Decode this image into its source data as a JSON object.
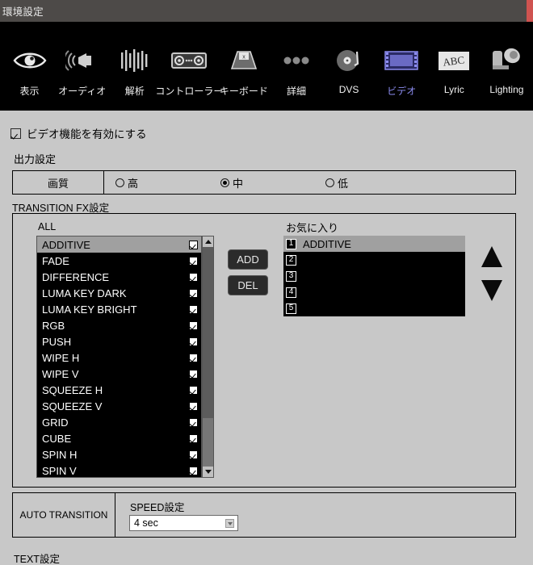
{
  "window": {
    "title": "環境設定",
    "close_label": "",
    "accent_red": "#cf5350",
    "titlebar_bg": "#4d4a48",
    "panel_bg": "#c8c8c8",
    "toolbar_bg": "#000000",
    "active_tab_color": "#8c8cf0"
  },
  "toolbar": {
    "items": [
      {
        "label": "表示",
        "icon": "eye-icon",
        "active": false
      },
      {
        "label": "オーディオ",
        "icon": "speaker-icon",
        "active": false
      },
      {
        "label": "解析",
        "icon": "waveform-icon",
        "active": false
      },
      {
        "label": "コントローラー",
        "icon": "controller-icon",
        "active": false
      },
      {
        "label": "キーボード",
        "icon": "keyboard-icon",
        "active": false
      },
      {
        "label": "詳細",
        "icon": "ellipsis-icon",
        "active": false
      },
      {
        "label": "DVS",
        "icon": "turntable-icon",
        "active": false
      },
      {
        "label": "ビデオ",
        "icon": "film-icon",
        "active": true
      },
      {
        "label": "Lyric",
        "icon": "abc-icon",
        "active": false
      },
      {
        "label": "Lighting",
        "icon": "spotlight-icon",
        "active": false
      }
    ]
  },
  "main": {
    "enable_video": {
      "label": "ビデオ機能を有効にする",
      "checked": true
    },
    "output_section_label": "出力設定",
    "quality": {
      "row_label": "画質",
      "options": [
        {
          "label": "高",
          "selected": false
        },
        {
          "label": "中",
          "selected": true
        },
        {
          "label": "低",
          "selected": false
        }
      ]
    },
    "transition_section_label": "TRANSITION  FX設定",
    "all_list": {
      "title": "ALL",
      "items": [
        {
          "name": "ADDITIVE",
          "checked": true,
          "selected": true
        },
        {
          "name": "FADE",
          "checked": true,
          "selected": false
        },
        {
          "name": "DIFFERENCE",
          "checked": true,
          "selected": false
        },
        {
          "name": "LUMA KEY DARK",
          "checked": true,
          "selected": false
        },
        {
          "name": "LUMA KEY BRIGHT",
          "checked": true,
          "selected": false
        },
        {
          "name": "RGB",
          "checked": true,
          "selected": false
        },
        {
          "name": "PUSH",
          "checked": true,
          "selected": false
        },
        {
          "name": "WIPE H",
          "checked": true,
          "selected": false
        },
        {
          "name": "WIPE V",
          "checked": true,
          "selected": false
        },
        {
          "name": "SQUEEZE H",
          "checked": true,
          "selected": false
        },
        {
          "name": "SQUEEZE V",
          "checked": true,
          "selected": false
        },
        {
          "name": "GRID",
          "checked": true,
          "selected": false
        },
        {
          "name": "CUBE",
          "checked": true,
          "selected": false
        },
        {
          "name": "SPIN H",
          "checked": true,
          "selected": false
        },
        {
          "name": "SPIN V",
          "checked": true,
          "selected": false
        }
      ]
    },
    "add_button": "ADD",
    "del_button": "DEL",
    "favorites": {
      "title": "お気に入り",
      "items": [
        {
          "num": "1",
          "name": "ADDITIVE",
          "selected": true
        },
        {
          "num": "2",
          "name": "",
          "selected": false
        },
        {
          "num": "3",
          "name": "",
          "selected": false
        },
        {
          "num": "4",
          "name": "",
          "selected": false
        },
        {
          "num": "5",
          "name": "",
          "selected": false
        }
      ]
    },
    "auto_transition": {
      "row_label": "AUTO TRANSITION",
      "speed_label": "SPEED設定",
      "speed_value": "4 sec"
    },
    "text_section_label": "TEXT設定"
  }
}
